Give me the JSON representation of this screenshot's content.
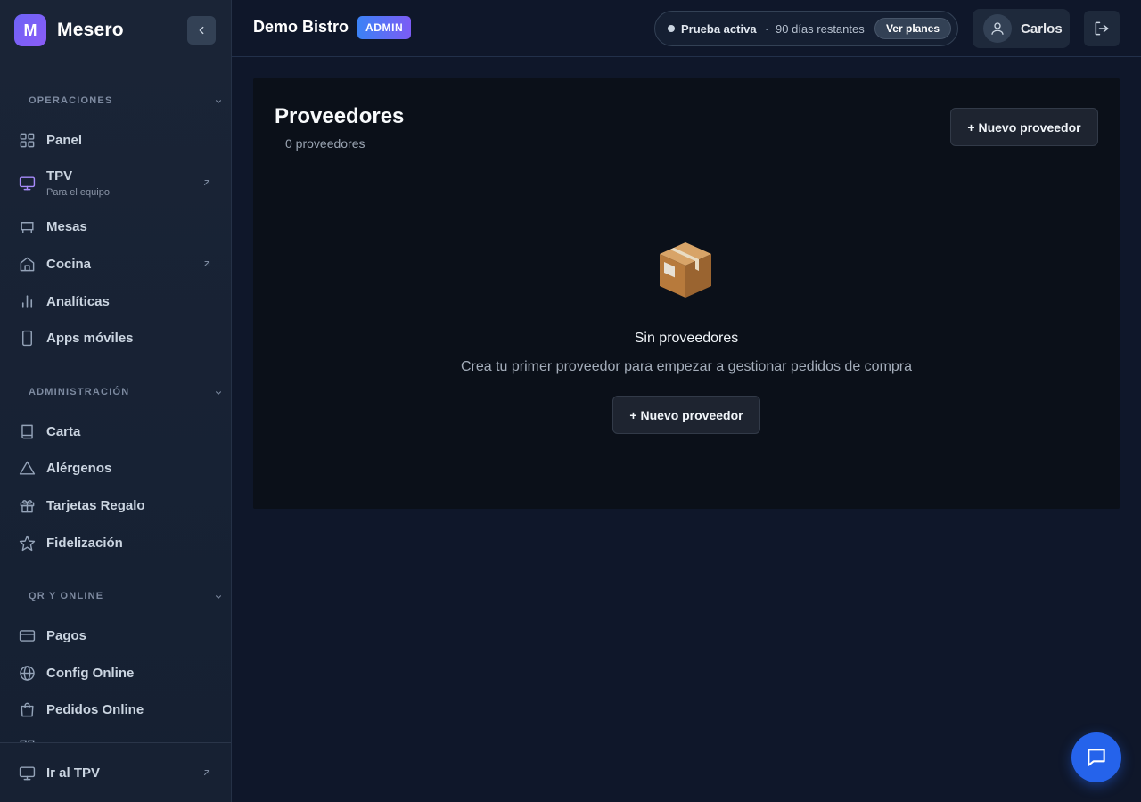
{
  "brand": {
    "initial": "M",
    "name": "Mesero"
  },
  "sidebar": {
    "sections": [
      {
        "title": "OPERACIONES"
      },
      {
        "title": "ADMINISTRACIÓN"
      },
      {
        "title": "QR Y ONLINE"
      }
    ],
    "items": [
      {
        "label": "Panel",
        "icon": "grid-icon"
      },
      {
        "label": "TPV",
        "sublabel": "Para el equipo",
        "icon": "monitor-icon",
        "external": true
      },
      {
        "label": "Mesas",
        "icon": "table-icon"
      },
      {
        "label": "Cocina",
        "icon": "home-icon",
        "external": true
      },
      {
        "label": "Analíticas",
        "icon": "bar-chart-icon"
      },
      {
        "label": "Apps móviles",
        "icon": "smartphone-icon"
      },
      {
        "label": "Carta",
        "icon": "book-icon"
      },
      {
        "label": "Alérgenos",
        "icon": "warning-triangle-icon"
      },
      {
        "label": "Tarjetas Regalo",
        "icon": "gift-icon"
      },
      {
        "label": "Fidelización",
        "icon": "star-icon"
      },
      {
        "label": "Pagos",
        "icon": "credit-card-icon"
      },
      {
        "label": "Config Online",
        "icon": "globe-icon"
      },
      {
        "label": "Pedidos Online",
        "icon": "shopping-bag-icon"
      }
    ],
    "footer": {
      "label": "Ir al TPV",
      "icon": "monitor-icon"
    }
  },
  "header": {
    "org_name": "Demo Bistro",
    "role_badge": "ADMIN",
    "trial": {
      "status": "Prueba activa",
      "separator": "·",
      "remaining": "90 días restantes",
      "plans_button": "Ver planes"
    },
    "user": {
      "name": "Carlos"
    }
  },
  "main": {
    "title": "Proveedores",
    "count_text": "0 proveedores",
    "new_button": "+ Nuevo proveedor",
    "empty": {
      "emoji": "📦",
      "title": "Sin proveedores",
      "description": "Crea tu primer proveedor para empezar a gestionar pedidos de compra",
      "button": "+ Nuevo proveedor"
    }
  },
  "colors": {
    "accent": "#6d63f6",
    "chat_button": "#2563eb",
    "background": "#0f172a"
  }
}
